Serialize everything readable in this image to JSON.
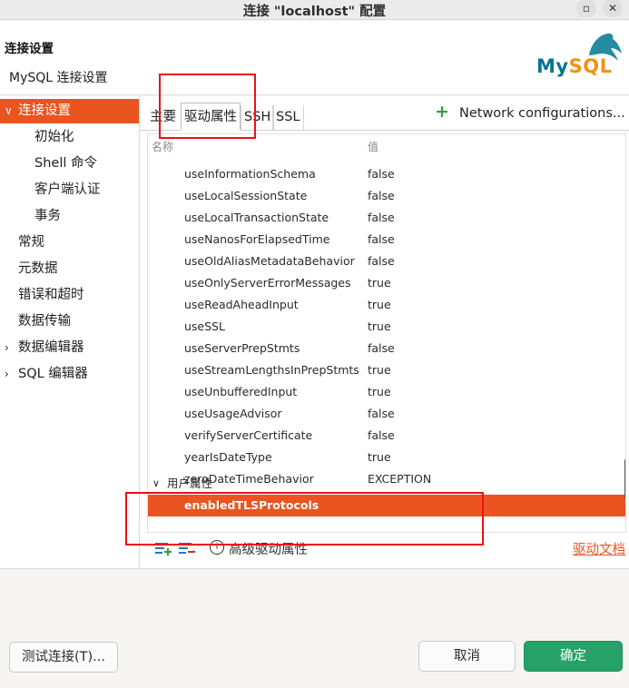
{
  "window": {
    "title": "连接 \"localhost\" 配置",
    "minimize_label": "▫",
    "close_label": "✕"
  },
  "header": {
    "title": "连接设置",
    "subtitle": "MySQL 连接设置",
    "logo_text_my": "My",
    "logo_text_sql": "SQL"
  },
  "sidebar": {
    "items": [
      {
        "label": "连接设置",
        "chevron": "∨"
      },
      {
        "label": "初始化"
      },
      {
        "label": "Shell 命令"
      },
      {
        "label": "客户端认证"
      },
      {
        "label": "事务"
      },
      {
        "label": "常规"
      },
      {
        "label": "元数据"
      },
      {
        "label": "错误和超时"
      },
      {
        "label": "数据传输"
      },
      {
        "label": "数据编辑器",
        "chevron": "›"
      },
      {
        "label": "SQL 编辑器",
        "chevron": "›"
      }
    ]
  },
  "tabs": [
    {
      "label": "主要"
    },
    {
      "label": "驱动属性"
    },
    {
      "label": "SSH"
    },
    {
      "label": "SSL"
    }
  ],
  "network_config": {
    "label": "Network configurations..."
  },
  "table": {
    "columns": [
      "名称",
      "值"
    ],
    "rows": [
      {
        "name": "useInformationSchema",
        "value": "false"
      },
      {
        "name": "useLocalSessionState",
        "value": "false"
      },
      {
        "name": "useLocalTransactionState",
        "value": "false"
      },
      {
        "name": "useNanosForElapsedTime",
        "value": "false"
      },
      {
        "name": "useOldAliasMetadataBehavior",
        "value": "false"
      },
      {
        "name": "useOnlyServerErrorMessages",
        "value": "true"
      },
      {
        "name": "useReadAheadInput",
        "value": "true"
      },
      {
        "name": "useSSL",
        "value": "true"
      },
      {
        "name": "useServerPrepStmts",
        "value": "false"
      },
      {
        "name": "useStreamLengthsInPrepStmts",
        "value": "true"
      },
      {
        "name": "useUnbufferedInput",
        "value": "true"
      },
      {
        "name": "useUsageAdvisor",
        "value": "false"
      },
      {
        "name": "verifyServerCertificate",
        "value": "false"
      },
      {
        "name": "yearIsDateType",
        "value": "true"
      },
      {
        "name": "zeroDateTimeBehavior",
        "value": "EXCEPTION"
      }
    ],
    "user_group": {
      "label": "用户属性",
      "chevron": "∨"
    },
    "selected_row": {
      "name": "enabledTLSProtocols"
    }
  },
  "bottom_toolbar": {
    "advanced_label": "高级驱动属性",
    "advanced_icon": "i",
    "driver_docs_label": "驱动文档"
  },
  "footer": {
    "test_label": "测试连接(T)...",
    "cancel_label": "取消",
    "ok_label": "确定"
  },
  "colors": {
    "accent": "#e95420",
    "ok_green": "#26a269",
    "annotation_red": "#ee1111"
  }
}
